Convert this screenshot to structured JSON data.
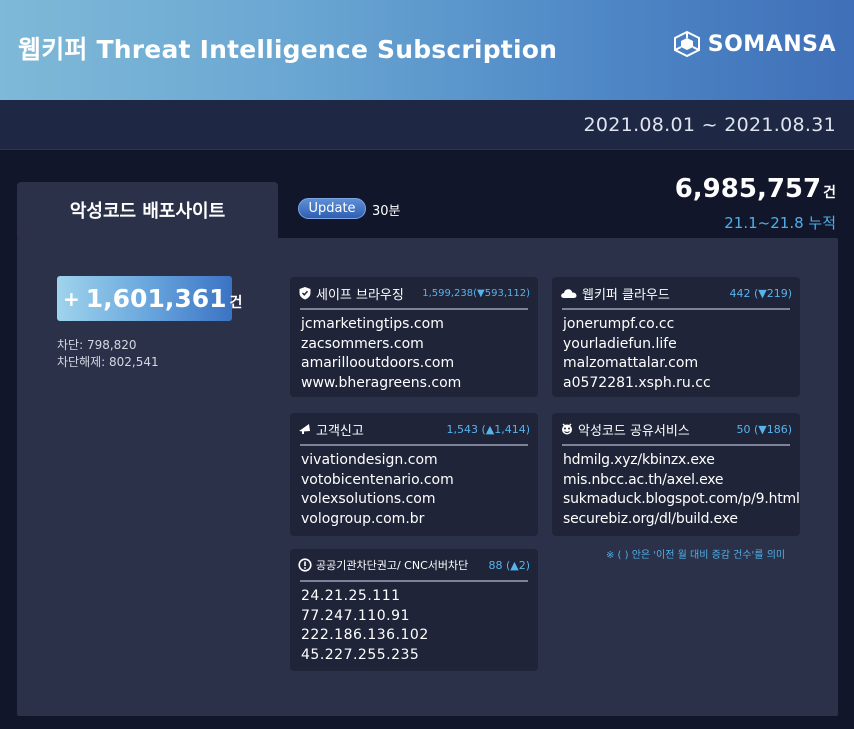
{
  "header": {
    "title": "웹키퍼 Threat Intelligence Subscription",
    "brand": "SOMANSA"
  },
  "date_range": "2021.08.01 ~ 2021.08.31",
  "tab": {
    "label": "악성코드 배포사이트"
  },
  "update": {
    "badge": "Update",
    "interval": "30분"
  },
  "total": {
    "number": "6,985,757",
    "unit": "건",
    "period": "21.1~21.8 누적"
  },
  "summary": {
    "plus": "+",
    "number": "1,601,361",
    "unit": "건",
    "blocked": "차단: 798,820",
    "unblocked": "차단해제: 802,541"
  },
  "cards": {
    "safe_browsing": {
      "title": "세이프 브라우징",
      "count": "1,599,238(▼593,112)",
      "items": [
        "jcmarketingtips.com",
        "zacsommers.com",
        "amarillooutdoors.com",
        "www.bheragreens.com"
      ]
    },
    "cloud": {
      "title": "웹키퍼 클라우드",
      "count": "442 (▼219)",
      "items": [
        "jonerumpf.co.cc",
        "yourladiefun.life",
        "malzomattalar.com",
        "a0572281.xsph.ru.cc"
      ]
    },
    "customer": {
      "title": "고객신고",
      "count": "1,543 (▲1,414)",
      "items": [
        "vivationdesign.com",
        "votobicentenario.com",
        "volexsolutions.com",
        "vologroup.com.br"
      ]
    },
    "malware_share": {
      "title": "악성코드 공유서비스",
      "count": "50 (▼186)",
      "items": [
        "hdmilg.xyz/kbinzx.exe",
        "mis.nbcc.ac.th/axel.exe",
        "sukmaduck.blogspot.com/p/9.html",
        "securebiz.org/dl/build.exe"
      ]
    },
    "public_agency": {
      "title": "공공기관차단권고/ CNC서버차단",
      "count": "88 (▲2)",
      "items": [
        "24.21.25.111",
        "77.247.110.91",
        "222.186.136.102",
        "45.227.255.235"
      ]
    }
  },
  "footnote": "※ ( ) 안은 '이전 월 대비 증감 건수'를 의미",
  "colors": {
    "background": "#11162a",
    "panel": "#2b3149",
    "card": "#1f2438",
    "accent": "#4fb0e8"
  }
}
